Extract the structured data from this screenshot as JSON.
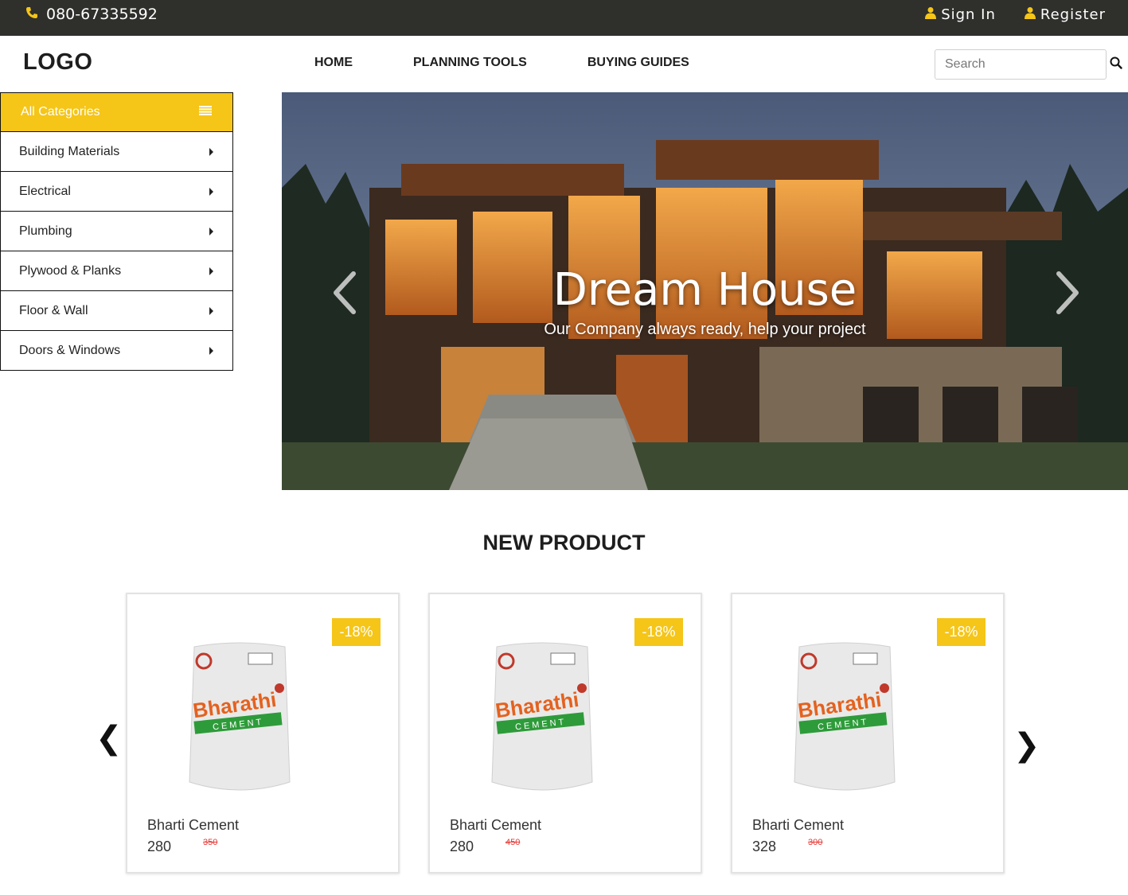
{
  "topbar": {
    "phone": "080-67335592",
    "sign_in": "Sign In",
    "register": "Register"
  },
  "header": {
    "logo": "LOGO",
    "nav": [
      "HOME",
      "PLANNING TOOLS",
      "BUYING GUIDES"
    ],
    "search_placeholder": "Search"
  },
  "sidebar": {
    "title": "All Categories",
    "items": [
      "Building Materials",
      "Electrical",
      "Plumbing",
      "Plywood & Planks",
      "Floor & Wall",
      "Doors & Windows"
    ]
  },
  "hero": {
    "title": "Dream House",
    "subtitle": "Our Company always ready, help your project"
  },
  "products": {
    "section_title": "NEW PRODUCT",
    "items": [
      {
        "name": "Bharti Cement",
        "price": "280",
        "old_price": "350",
        "discount": "-18%"
      },
      {
        "name": "Bharti Cement",
        "price": "280",
        "old_price": "450",
        "discount": "-18%"
      },
      {
        "name": "Bharti Cement",
        "price": "328",
        "old_price": "300",
        "discount": "-18%"
      }
    ]
  },
  "icons": {
    "phone": "phone-icon",
    "user": "user-icon",
    "search": "search-icon",
    "menu": "list-icon",
    "caret": "caret-right-icon",
    "prev": "chevron-left-icon",
    "next": "chevron-right-icon"
  },
  "colors": {
    "accent": "#f5c518",
    "topbar": "#2f2f2c",
    "strike_price": "#e53935"
  }
}
